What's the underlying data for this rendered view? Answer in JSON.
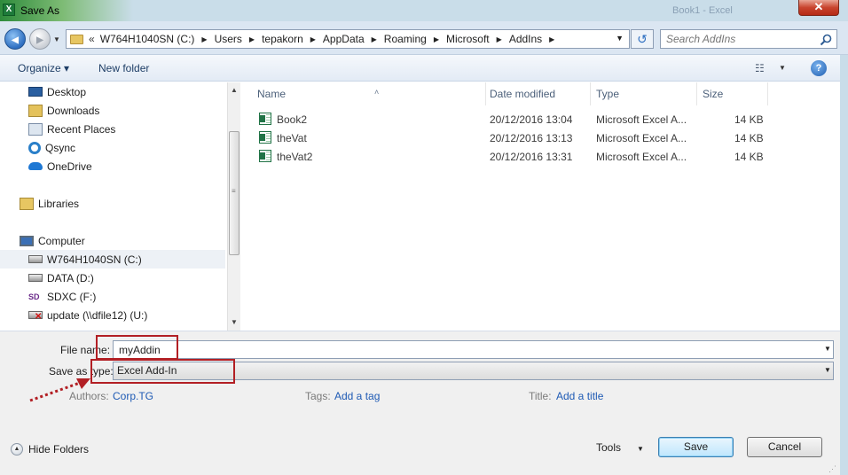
{
  "window": {
    "title": "Save As",
    "app_icon_letter": "X",
    "background_ghost_text": "Book1 - Excel",
    "close_glyph": "✕"
  },
  "navigation": {
    "back_glyph": "◀",
    "forward_glyph": "▶",
    "breadcrumb_lead": "«",
    "breadcrumbs": [
      "W764H1040SN (C:)",
      "Users",
      "tepakorn",
      "AppData",
      "Roaming",
      "Microsoft",
      "AddIns"
    ],
    "search_placeholder": "Search AddIns"
  },
  "toolbar": {
    "organize_label": "Organize ▾",
    "new_folder_label": "New folder",
    "view_glyph": "☷",
    "help_glyph": "?"
  },
  "nav_pane": {
    "favorites": [
      {
        "label": "Desktop",
        "icon": "desktop-icon"
      },
      {
        "label": "Downloads",
        "icon": "downloads-icon"
      },
      {
        "label": "Recent Places",
        "icon": "recent-places-icon"
      },
      {
        "label": "Qsync",
        "icon": "qsync-icon"
      },
      {
        "label": "OneDrive",
        "icon": "onedrive-icon"
      }
    ],
    "libraries_label": "Libraries",
    "computer_label": "Computer",
    "drives": [
      {
        "label": "W764H1040SN (C:)",
        "icon": "hard-drive-icon",
        "selected": true
      },
      {
        "label": "DATA (D:)",
        "icon": "hard-drive-icon",
        "selected": false
      },
      {
        "label": "SDXC (F:)",
        "icon": "sd-card-icon",
        "selected": false
      },
      {
        "label": "update (\\\\dfile12) (U:)",
        "icon": "network-drive-icon",
        "selected": false
      }
    ]
  },
  "file_list": {
    "columns": [
      "Name",
      "Date modified",
      "Type",
      "Size"
    ],
    "sort_glyph": "˄",
    "files": [
      {
        "name": "Book2",
        "date": "20/12/2016 13:04",
        "type": "Microsoft Excel A...",
        "size": "14 KB"
      },
      {
        "name": "theVat",
        "date": "20/12/2016 13:13",
        "type": "Microsoft Excel A...",
        "size": "14 KB"
      },
      {
        "name": "theVat2",
        "date": "20/12/2016 13:31",
        "type": "Microsoft Excel A...",
        "size": "14 KB"
      }
    ]
  },
  "form": {
    "file_name_label": "File name:",
    "file_name_value": "myAddin",
    "save_as_type_label": "Save as type:",
    "save_as_type_value": "Excel Add-In",
    "authors_label": "Authors:",
    "authors_value": "Corp.TG",
    "tags_label": "Tags:",
    "tags_value": "Add a tag",
    "title_label": "Title:",
    "title_value": "Add a title"
  },
  "footer": {
    "hide_folders_label": "Hide Folders",
    "tools_label": "Tools",
    "save_label": "Save",
    "cancel_label": "Cancel"
  },
  "colors": {
    "highlight": "#b21f24",
    "link": "#1e5ab4",
    "accent": "#3c7fb1"
  }
}
